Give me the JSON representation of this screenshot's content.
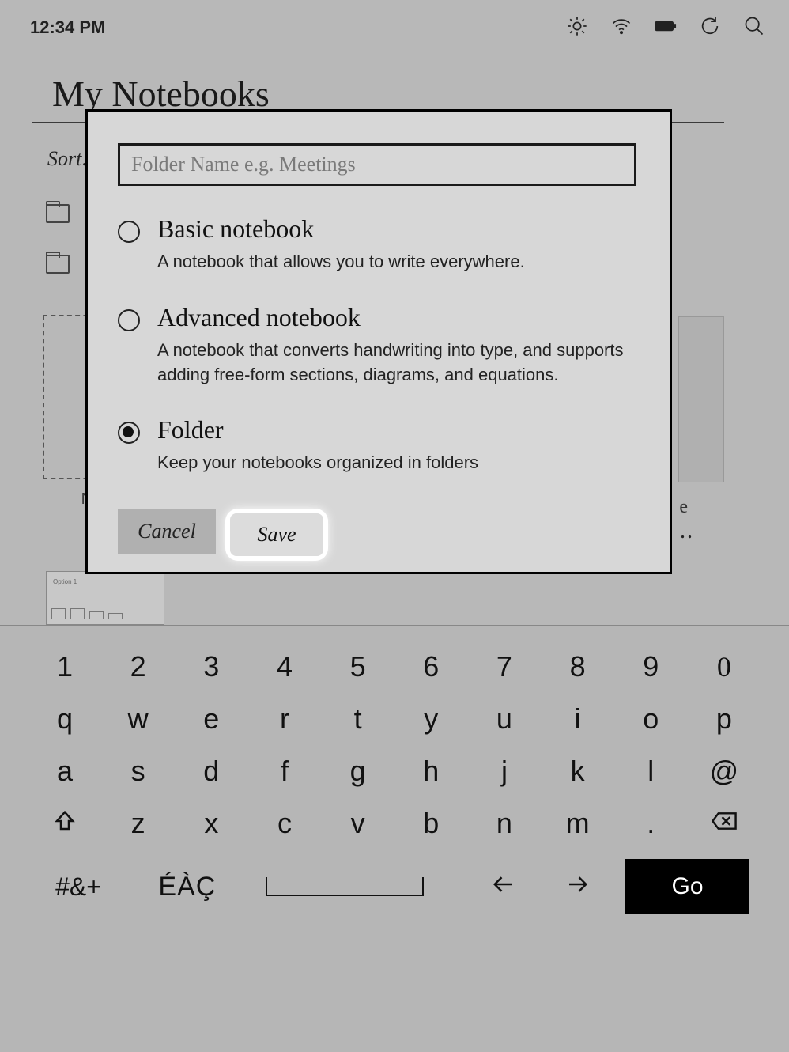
{
  "statusbar": {
    "time": "12:34 PM"
  },
  "page": {
    "title": "My Notebooks",
    "sort_label": "Sort:",
    "new_label": "NEW",
    "side_e": "e",
    "side_dots": ".."
  },
  "modal": {
    "input_placeholder": "Folder Name e.g. Meetings",
    "options": [
      {
        "title": "Basic notebook",
        "desc": "A notebook that allows you to write everywhere.",
        "selected": false
      },
      {
        "title": "Advanced notebook",
        "desc": "A notebook that converts handwriting into type, and supports adding free-form sections, diagrams, and equations.",
        "selected": false
      },
      {
        "title": "Folder",
        "desc": "Keep your notebooks organized in folders",
        "selected": true
      }
    ],
    "cancel": "Cancel",
    "save": "Save"
  },
  "keyboard": {
    "row1": [
      "1",
      "2",
      "3",
      "4",
      "5",
      "6",
      "7",
      "8",
      "9",
      "0"
    ],
    "row2": [
      "q",
      "w",
      "e",
      "r",
      "t",
      "y",
      "u",
      "i",
      "o",
      "p"
    ],
    "row3": [
      "a",
      "s",
      "d",
      "f",
      "g",
      "h",
      "j",
      "k",
      "l",
      "@"
    ],
    "row4_letters": [
      "z",
      "x",
      "c",
      "v",
      "b",
      "n",
      "m",
      "."
    ],
    "symbols": "#&+",
    "accents": "ÉÀÇ",
    "go": "Go"
  }
}
